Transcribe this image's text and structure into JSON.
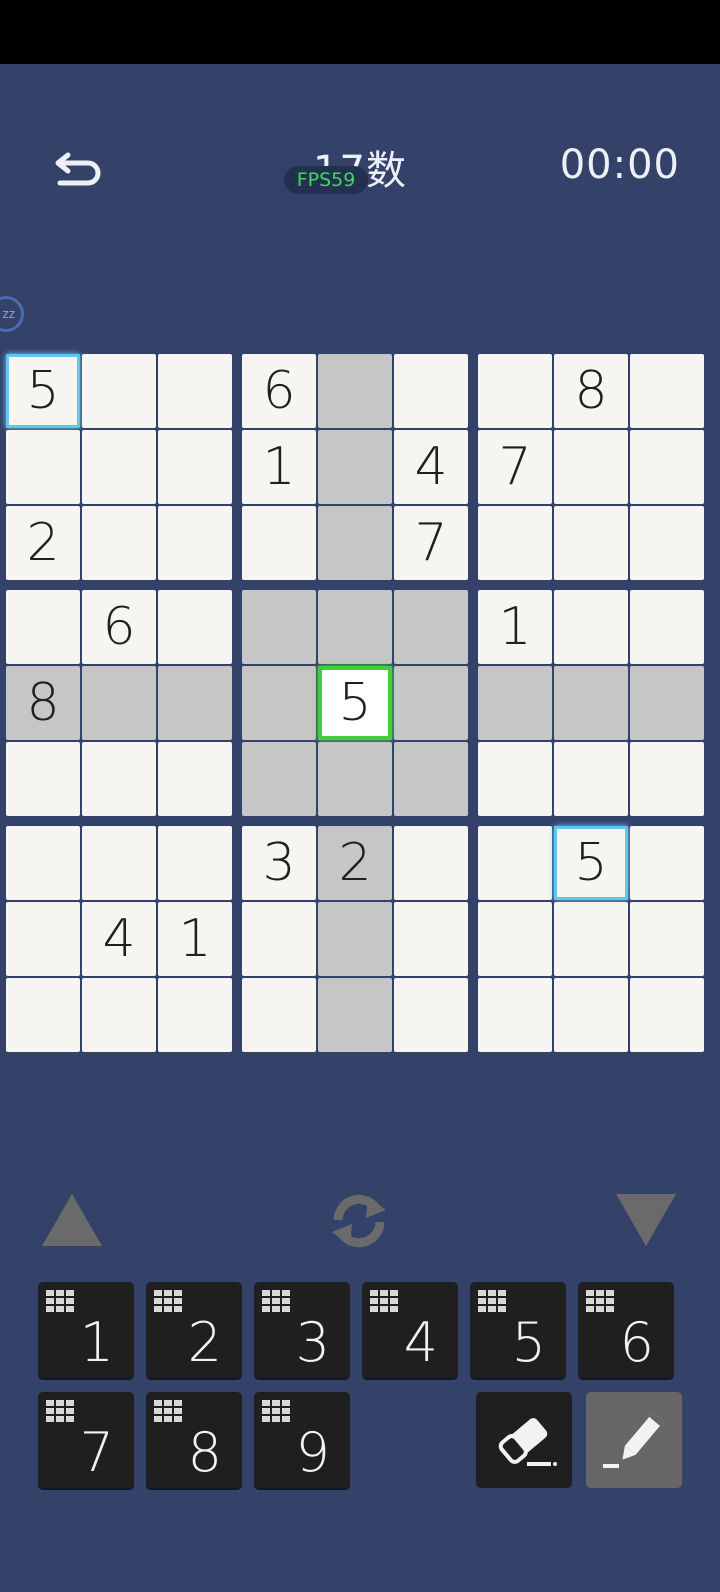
{
  "header": {
    "title": "17数",
    "fps": "FPS59",
    "timer": "00:00"
  },
  "badge": {
    "label": "zz"
  },
  "board": {
    "values": [
      [
        "5",
        "",
        "",
        "6",
        "",
        "",
        "",
        "8",
        ""
      ],
      [
        "",
        "",
        "",
        "1",
        "",
        "4",
        "7",
        "",
        ""
      ],
      [
        "2",
        "",
        "",
        "",
        "",
        "7",
        "",
        "",
        ""
      ],
      [
        "",
        "6",
        "",
        "",
        "",
        "",
        "1",
        "",
        ""
      ],
      [
        "8",
        "",
        "",
        "",
        "5",
        "",
        "",
        "",
        ""
      ],
      [
        "",
        "",
        "",
        "",
        "",
        "",
        "",
        "",
        ""
      ],
      [
        "",
        "",
        "",
        "3",
        "2",
        "",
        "",
        "5",
        ""
      ],
      [
        "",
        "4",
        "1",
        "",
        "",
        "",
        "",
        "",
        ""
      ],
      [
        "",
        "",
        "",
        "",
        "",
        "",
        "",
        "",
        ""
      ]
    ],
    "highlighted": [
      [
        0,
        4
      ],
      [
        1,
        4
      ],
      [
        2,
        4
      ],
      [
        3,
        4
      ],
      [
        5,
        4
      ],
      [
        6,
        4
      ],
      [
        7,
        4
      ],
      [
        8,
        4
      ],
      [
        4,
        0
      ],
      [
        4,
        1
      ],
      [
        4,
        2
      ],
      [
        4,
        3
      ],
      [
        4,
        5
      ],
      [
        4,
        6
      ],
      [
        4,
        7
      ],
      [
        4,
        8
      ],
      [
        3,
        3
      ],
      [
        3,
        5
      ],
      [
        5,
        3
      ],
      [
        5,
        5
      ]
    ],
    "selected": [
      4,
      4
    ],
    "same_number": [
      [
        0,
        0
      ],
      [
        6,
        7
      ]
    ]
  },
  "numpad": {
    "digits": [
      "1",
      "2",
      "3",
      "4",
      "5",
      "6",
      "7",
      "8",
      "9"
    ]
  },
  "tools": {
    "eraser": "eraser-icon",
    "pencil": "pencil-icon",
    "pencil_active": true
  },
  "colors": {
    "background": "#34426a",
    "cell": "#f6f5f2",
    "highlight": "#c6c6c6",
    "selected_outline": "#3fcf3a",
    "same_number_outline": "#5ec6ef",
    "fps_text": "#3fd65a"
  }
}
